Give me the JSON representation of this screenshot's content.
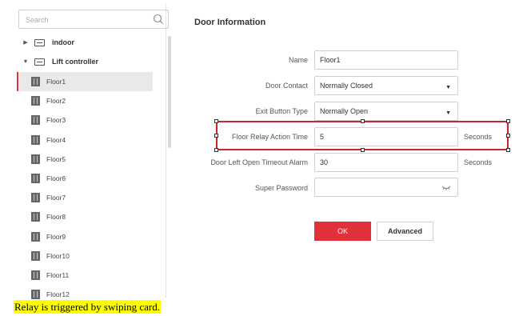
{
  "search": {
    "placeholder": "Search"
  },
  "tree": {
    "nodes": [
      {
        "label": "indoor",
        "expanded": false
      },
      {
        "label": "Lift controller",
        "expanded": true
      }
    ],
    "floors": [
      "Floor1",
      "Floor2",
      "Floor3",
      "Floor4",
      "Floor5",
      "Floor6",
      "Floor7",
      "Floor8",
      "Floor9",
      "Floor10",
      "Floor11",
      "Floor12"
    ],
    "selected": "Floor1"
  },
  "form": {
    "title": "Door Information",
    "name_label": "Name",
    "name_value": "Floor1",
    "door_contact_label": "Door Contact",
    "door_contact_value": "Normally Closed",
    "exit_button_label": "Exit Button Type",
    "exit_button_value": "Normally Open",
    "relay_time_label": "Floor Relay Action Time",
    "relay_time_value": "5",
    "relay_time_unit": "Seconds",
    "timeout_label": "Door Left Open Timeout Alarm",
    "timeout_value": "30",
    "timeout_unit": "Seconds",
    "super_password_label": "Super Password",
    "super_password_value": ""
  },
  "buttons": {
    "ok": "OK",
    "advanced": "Advanced"
  },
  "caption": "Relay is triggered by swiping card.",
  "colors": {
    "accent": "#e0303a",
    "highlight_border": "#c8262c",
    "caption_bg": "#ffff00"
  },
  "icons": [
    "search-icon",
    "expand-arrow-icon",
    "controller-icon",
    "door-icon",
    "dropdown-arrow-icon",
    "eye-icon"
  ]
}
